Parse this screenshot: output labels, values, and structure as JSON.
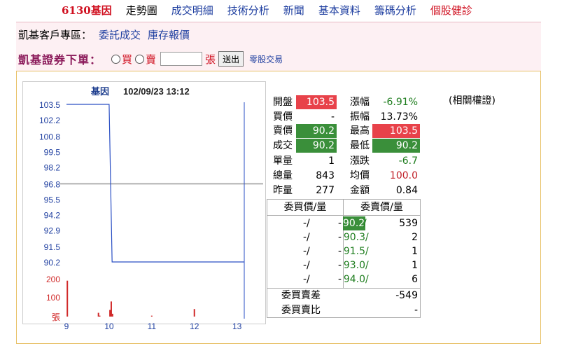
{
  "nav": {
    "items": [
      {
        "label": "6130基因",
        "style": "active"
      },
      {
        "label": "走勢圖",
        "style": "plain"
      },
      {
        "label": "成交明細",
        "style": "link"
      },
      {
        "label": "技術分析",
        "style": "link"
      },
      {
        "label": "新聞",
        "style": "link"
      },
      {
        "label": "基本資料",
        "style": "link"
      },
      {
        "label": "籌碼分析",
        "style": "link"
      },
      {
        "label": "個股健診",
        "style": "red"
      }
    ]
  },
  "broker": {
    "zone_label": "凱基客戶專區：",
    "link1": "委託成交",
    "link2": "庫存報價",
    "order_title": "凱基證券下單：",
    "buy_label": "買",
    "sell_label": "賣",
    "qty_value": "",
    "unit_label": "張",
    "send_label": "送出",
    "odd_label": "零股交易"
  },
  "chart_data": {
    "type": "line",
    "title": "基因",
    "timestamp": "102/09/23 13:12",
    "price_ticks": [
      "103.5",
      "102.2",
      "100.8",
      "99.5",
      "98.2",
      "96.8",
      "95.5",
      "94.2",
      "92.9",
      "91.5",
      "90.2"
    ],
    "price_ylim": [
      90.2,
      103.5
    ],
    "reference_price": 96.8,
    "volume_ticks": [
      "200",
      "100",
      "張"
    ],
    "volume_ylim": [
      0,
      200
    ],
    "x_ticks": [
      "9",
      "10",
      "11",
      "12",
      "13"
    ],
    "price_series": {
      "name": "price",
      "x": [
        9.0,
        10.0,
        10.07,
        10.1,
        13.17
      ],
      "y": [
        103.5,
        103.5,
        90.2,
        90.2,
        90.2
      ]
    },
    "volume_series": {
      "name": "volume",
      "x": [
        9.02,
        9.75,
        9.78,
        10.02,
        10.05,
        10.08,
        11.0,
        12.0
      ],
      "y": [
        190,
        20,
        5,
        35,
        80,
        15,
        5,
        40
      ]
    },
    "grid": false
  },
  "quote": {
    "open_label": "開盤",
    "open": "103.5",
    "bid_label": "買價",
    "bid": "-",
    "ask_label": "賣價",
    "ask": "90.2",
    "last_label": "成交",
    "last": "90.2",
    "vol_label": "單量",
    "vol": "1",
    "total_label": "總量",
    "total": "843",
    "prev_label": "昨量",
    "prev": "277",
    "chgpct_label": "漲幅",
    "chgpct": "-6.91%",
    "amp_label": "振幅",
    "amp": "13.73%",
    "high_label": "最高",
    "high": "103.5",
    "low_label": "最低",
    "low": "90.2",
    "chg_label": "漲跌",
    "chg": "-6.7",
    "avg_label": "均價",
    "avg": "100.0",
    "amt_label": "金額",
    "amt": "0.84"
  },
  "related_label": "(相關權證)",
  "book": {
    "bid_header": "委買價/量",
    "ask_header": "委賣價/量",
    "rows": [
      {
        "bid_price": "-",
        "bid_qty": "-",
        "ask_price": "90.2",
        "ask_qty": "539"
      },
      {
        "bid_price": "-",
        "bid_qty": "-",
        "ask_price": "90.3",
        "ask_qty": "2"
      },
      {
        "bid_price": "-",
        "bid_qty": "-",
        "ask_price": "91.5",
        "ask_qty": "1"
      },
      {
        "bid_price": "-",
        "bid_qty": "-",
        "ask_price": "93.0",
        "ask_qty": "1"
      },
      {
        "bid_price": "-",
        "bid_qty": "-",
        "ask_price": "94.0",
        "ask_qty": "6"
      }
    ],
    "diff_label": "委買賣差",
    "diff": "-549",
    "ratio_label": "委買賣比",
    "ratio": "-"
  },
  "colors": {
    "price_line": "#2a4fc4",
    "reference_line": "#b0b0b0",
    "volume_bar": "#d02828",
    "tick_price": "#1f3fa0",
    "tick_volume": "#d02828"
  }
}
